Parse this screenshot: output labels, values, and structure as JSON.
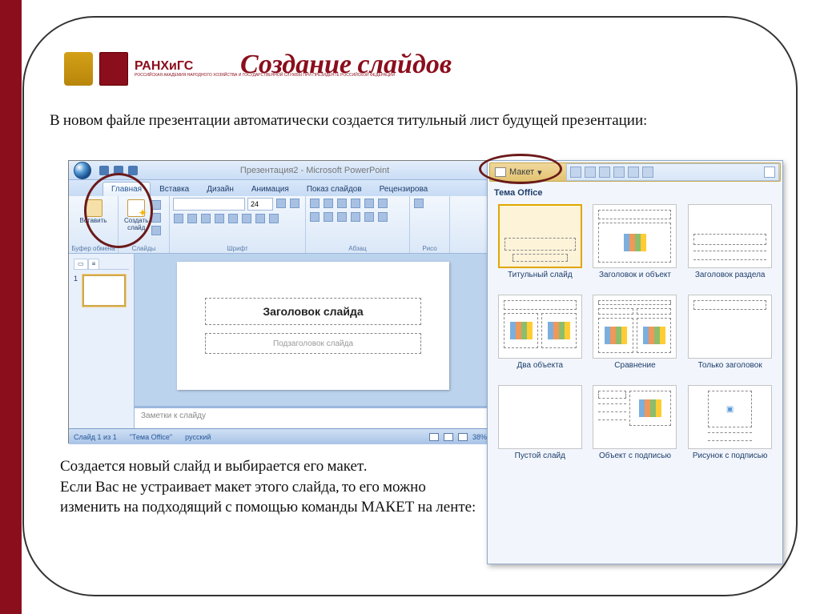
{
  "logo": {
    "name": "РАНХиГС",
    "sub": "РОССИЙСКАЯ АКАДЕМИЯ НАРОДНОГО ХОЗЯЙСТВА И ГОСУДАРСТВЕННОЙ СЛУЖБЫ ПРИ ПРЕЗИДЕНТЕ РОССИЙСКОЙ ФЕДЕРАЦИИ"
  },
  "title": "Создание слайдов",
  "para1": "В новом файле презентации автоматически создается титульный лист будущей презентации:",
  "para2": "Создается новый слайд и выбирается его макет.\nЕсли Вас не устраивает макет этого слайда, то его можно изменить на подходящий с помощью команды МАКЕТ на ленте:",
  "pp": {
    "window_title": "Презентация2 - Microsoft PowerPoint",
    "tabs": [
      "Главная",
      "Вставка",
      "Дизайн",
      "Анимация",
      "Показ слайдов",
      "Рецензирова"
    ],
    "groups": {
      "clipboard": {
        "label": "Буфер обмена",
        "paste": "Вставить"
      },
      "slides": {
        "label": "Слайды",
        "new_slide": "Создать\nслайд"
      },
      "font": {
        "label": "Шрифт",
        "size": "24"
      },
      "para": {
        "label": "Абзац"
      },
      "draw": {
        "label": "Рисо"
      }
    },
    "slide": {
      "title_ph": "Заголовок слайда",
      "sub_ph": "Подзаголовок слайда"
    },
    "notes_ph": "Заметки к слайду",
    "status": {
      "slide": "Слайд 1 из 1",
      "theme": "\"Тема Office\"",
      "lang": "русский",
      "zoom": "38%"
    }
  },
  "gallery": {
    "button": "Макет",
    "header": "Тема Office",
    "layouts": [
      {
        "name": "Титульный слайд",
        "kind": "title"
      },
      {
        "name": "Заголовок и объект",
        "kind": "title-content"
      },
      {
        "name": "Заголовок раздела",
        "kind": "section"
      },
      {
        "name": "Два объекта",
        "kind": "two-content"
      },
      {
        "name": "Сравнение",
        "kind": "comparison"
      },
      {
        "name": "Только заголовок",
        "kind": "title-only"
      },
      {
        "name": "Пустой слайд",
        "kind": "blank"
      },
      {
        "name": "Объект с подписью",
        "kind": "content-caption"
      },
      {
        "name": "Рисунок с подписью",
        "kind": "picture-caption"
      }
    ]
  }
}
